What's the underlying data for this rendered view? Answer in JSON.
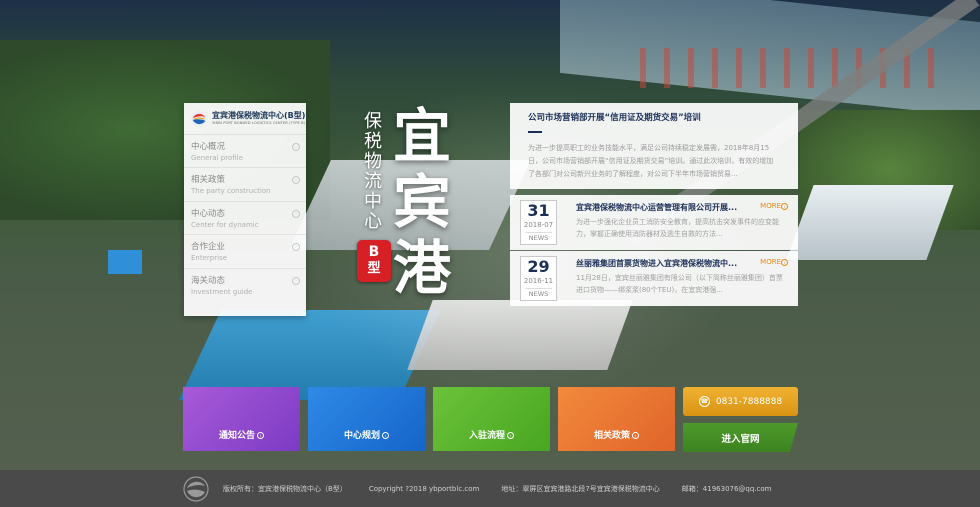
{
  "brand": {
    "name_cn": "宜宾港保税物流中心(B型)",
    "name_en": "YIBIN PORT BONDED LOGISTICS CENTER (TYPE B)"
  },
  "sidebar": {
    "items": [
      {
        "cn": "中心概况",
        "en": "General profile"
      },
      {
        "cn": "相关政策",
        "en": "The party construction"
      },
      {
        "cn": "中心动态",
        "en": "Center for dynamic"
      },
      {
        "cn": "合作企业",
        "en": "Enterprise"
      },
      {
        "cn": "海关动态",
        "en": "Investment guide"
      }
    ],
    "arrow_glyph": "›"
  },
  "hero": {
    "sub_title": "保税物流中心",
    "main_title": "宜宾港",
    "badge_letter": "B",
    "badge_char": "型"
  },
  "news": {
    "featured": {
      "title": "公司市场营销部开展“信用证及期货交易”培训",
      "text": "为进一步提高职工的业务技能水平，满足公司持续稳定发展需，2018年8月15日，公司市场营销部开展“信用证及期货交易”培训。通过此次培训，有效的增加了各部门对公司新兴业务的了解程度，对公司下半年市场营销贸易..."
    },
    "label": "NEWS",
    "more_label": "MORE",
    "more_glyph": "›",
    "items": [
      {
        "day": "31",
        "ym": "2018-07",
        "title": "宜宾港保税物流中心运营管理有限公司开展...",
        "text": "为进一步强化企业员工消防安全教育，提高抗击突发事件的应变能力，掌握正确使用消防器材及逃生自救的方法..."
      },
      {
        "day": "29",
        "ym": "2016-11",
        "title": "丝丽雅集团首票货物进入宜宾港保税物流中...",
        "text": "11月28日，宜宾丝丽雅集团有限公司（以下简称丝丽雅集团）首票进口货物——绑浆浆(80个TEU)，在宜宾港强..."
      }
    ]
  },
  "tiles": [
    {
      "label": "通知公告",
      "color": "#8a47cc"
    },
    {
      "label": "中心规划",
      "color": "#1f74d6"
    },
    {
      "label": "入驻流程",
      "color": "#5ab32c"
    },
    {
      "label": "相关政策",
      "color": "#ea7433"
    }
  ],
  "tile_glyph": "›",
  "contact": {
    "phone": "0831-7888888",
    "phone_icon": "phone-icon",
    "enter_label": "进入官网"
  },
  "footer": {
    "owner": "版权所有：宜宾港保税物流中心（B型）",
    "copyright": "Copyright ?2018 ybportblc.com",
    "address": "地址：翠屏区宜宾港路北段7号宜宾港保税物流中心",
    "email": "邮箱：41963076@qq.com"
  },
  "colors": {
    "navy": "#1c2f59",
    "accent_orange": "#e8891b",
    "badge_red": "#d71f26",
    "footer_bg": "#4a4a4a"
  }
}
